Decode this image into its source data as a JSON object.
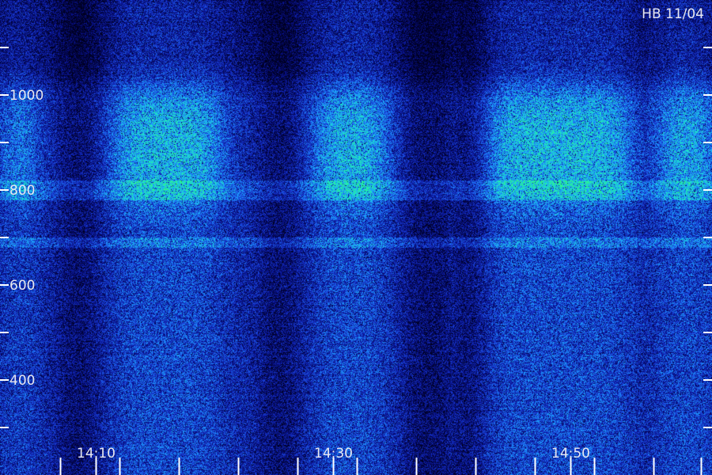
{
  "chart_data": {
    "type": "heatmap",
    "title": "HB 11/04",
    "xlabel": "",
    "ylabel": "",
    "x_tick_labels": [
      "14:10",
      "14:30",
      "14:50"
    ],
    "x_tick_minutes": [
      10,
      30,
      50
    ],
    "x_range_minutes": [
      1.9,
      61.9
    ],
    "x_minor_ticks_minutes": [
      7,
      12,
      17,
      22,
      27,
      32,
      37,
      42,
      47,
      52,
      57,
      61
    ],
    "y_tick_labels": [
      "400",
      "600",
      "800",
      "1000"
    ],
    "y_tick_values": [
      400,
      600,
      800,
      1000
    ],
    "y_minor_tick_values": [
      300,
      500,
      700,
      900,
      1100
    ],
    "y_range": [
      200,
      1200
    ],
    "colormap": [
      "#000020",
      "#08108a",
      "#1a3fd8",
      "#1d9bff",
      "#1de7c8",
      "#33ff66"
    ],
    "bright_periods_minutes": [
      [
        2.5,
        4.5
      ],
      [
        11.5,
        20.5
      ],
      [
        28.5,
        34.5
      ],
      [
        43.0,
        55.0
      ],
      [
        57.5,
        61.9
      ]
    ],
    "dark_gaps_minutes": [
      [
        7.0,
        10.0
      ],
      [
        24.0,
        27.0
      ],
      [
        36.0,
        40.0
      ],
      [
        40.0,
        42.5
      ]
    ],
    "bright_band_hz": [
      [
        780,
        820
      ],
      [
        680,
        700
      ]
    ],
    "emission_range_hz": [
      780,
      1000
    ]
  }
}
